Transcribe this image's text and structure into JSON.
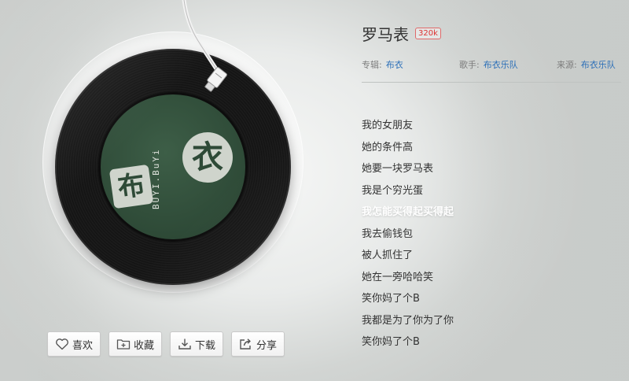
{
  "song": {
    "title": "罗马表",
    "quality": "320k",
    "album_key": "专辑:",
    "album": "布衣",
    "singer_key": "歌手:",
    "singer": "布衣乐队",
    "source_key": "来源:",
    "source": "布衣乐队"
  },
  "record": {
    "label_text": "BUYI.BuYi",
    "logo_left": "布",
    "logo_right": "衣"
  },
  "lyrics": [
    "我的女朋友",
    "她的条件高",
    "她要一块罗马表",
    "我是个穷光蛋",
    "我怎能买得起买得起",
    "我去偷钱包",
    "被人抓住了",
    "她在一旁哈哈笑",
    "笑你妈了个B",
    "我都是为了你为了你",
    "笑你妈了个B"
  ],
  "current_lyric_index": 4,
  "actions": {
    "like": "喜欢",
    "collect": "收藏",
    "download": "下载",
    "share": "分享"
  },
  "icons": {
    "like": "heart-icon",
    "collect": "folder-add-icon",
    "download": "download-icon",
    "share": "share-icon"
  },
  "colors": {
    "link": "#2b6fb8",
    "quality_badge": "#d33333",
    "label_green": "#2e4a37"
  }
}
